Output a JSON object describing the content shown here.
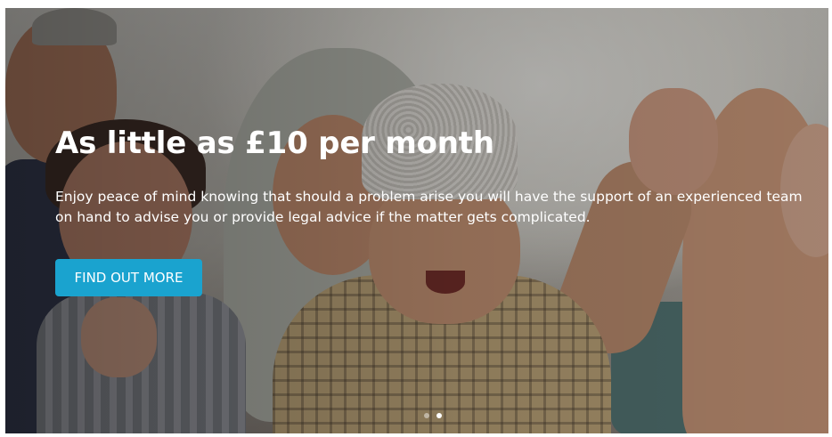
{
  "hero": {
    "headline": "As little as £10 per month",
    "subtext": "Enjoy peace of mind knowing that should a problem arise you will have the support of an experienced team on hand to advise you or provide legal advice if the matter gets complicated.",
    "cta_label": "FIND OUT MORE",
    "accent_color": "#1aa3cf",
    "carousel": {
      "slide_count": 2,
      "active_index": 1
    }
  }
}
